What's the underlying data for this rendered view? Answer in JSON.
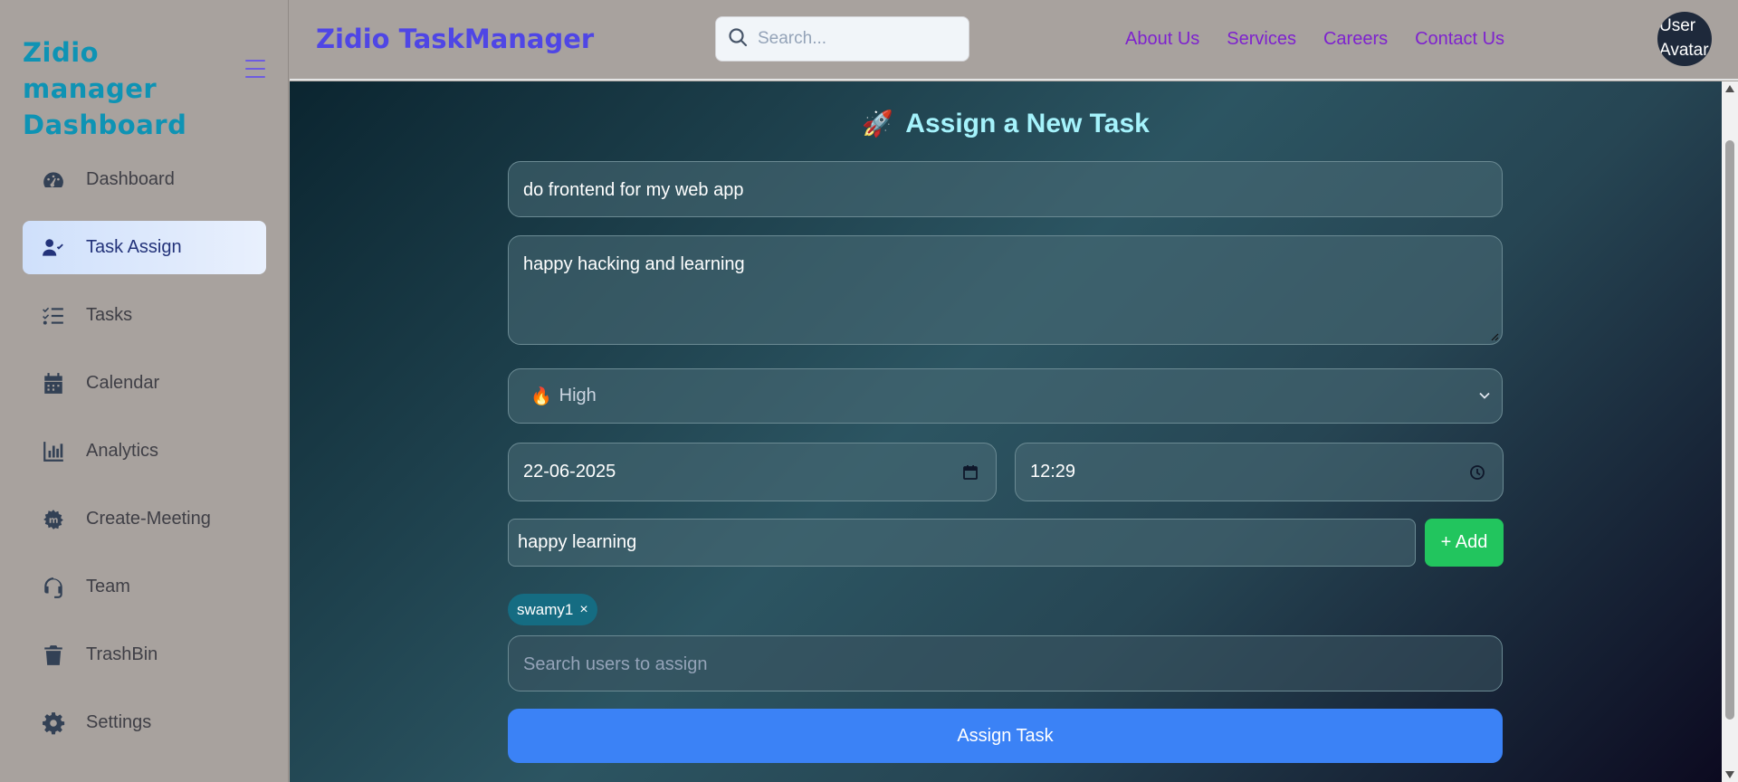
{
  "sidebar": {
    "brand": "Zidio manager Dashboard",
    "items": [
      {
        "label": "Dashboard",
        "icon": "gauge-icon",
        "active": false
      },
      {
        "label": "Task Assign",
        "icon": "user-check-icon",
        "active": true
      },
      {
        "label": "Tasks",
        "icon": "list-check-icon",
        "active": false
      },
      {
        "label": "Calendar",
        "icon": "calendar-icon",
        "active": false
      },
      {
        "label": "Analytics",
        "icon": "bar-chart-icon",
        "active": false
      },
      {
        "label": "Create-Meeting",
        "icon": "meeting-icon",
        "active": false
      },
      {
        "label": "Team",
        "icon": "headset-icon",
        "active": false
      },
      {
        "label": "TrashBin",
        "icon": "trash-icon",
        "active": false
      },
      {
        "label": "Settings",
        "icon": "gear-icon",
        "active": false
      }
    ]
  },
  "header": {
    "title": "Zidio TaskManager",
    "search_placeholder": "Search...",
    "links": [
      "About Us",
      "Services",
      "Careers",
      "Contact Us"
    ],
    "avatar_alt": "User Avatar"
  },
  "form": {
    "heading": "Assign a New Task",
    "heading_icon": "🚀",
    "title_value": "do frontend for my web app",
    "description_value": "happy hacking and learning",
    "priority_icon": "🔥",
    "priority_value": "High",
    "date_value": "22-06-2025",
    "time_value": "12:29",
    "subtask_value": "happy learning",
    "add_label": "+ Add",
    "assigned_chip": "swamy1",
    "chip_remove": "×",
    "users_placeholder": "Search users to assign",
    "submit_label": "Assign Task"
  },
  "colors": {
    "brand": "#0e93b4",
    "title": "#4f46e5",
    "links": "#7e22ce",
    "add_button": "#22c55e",
    "assign_button": "#3b82f6",
    "heading": "#a5f3fc"
  }
}
